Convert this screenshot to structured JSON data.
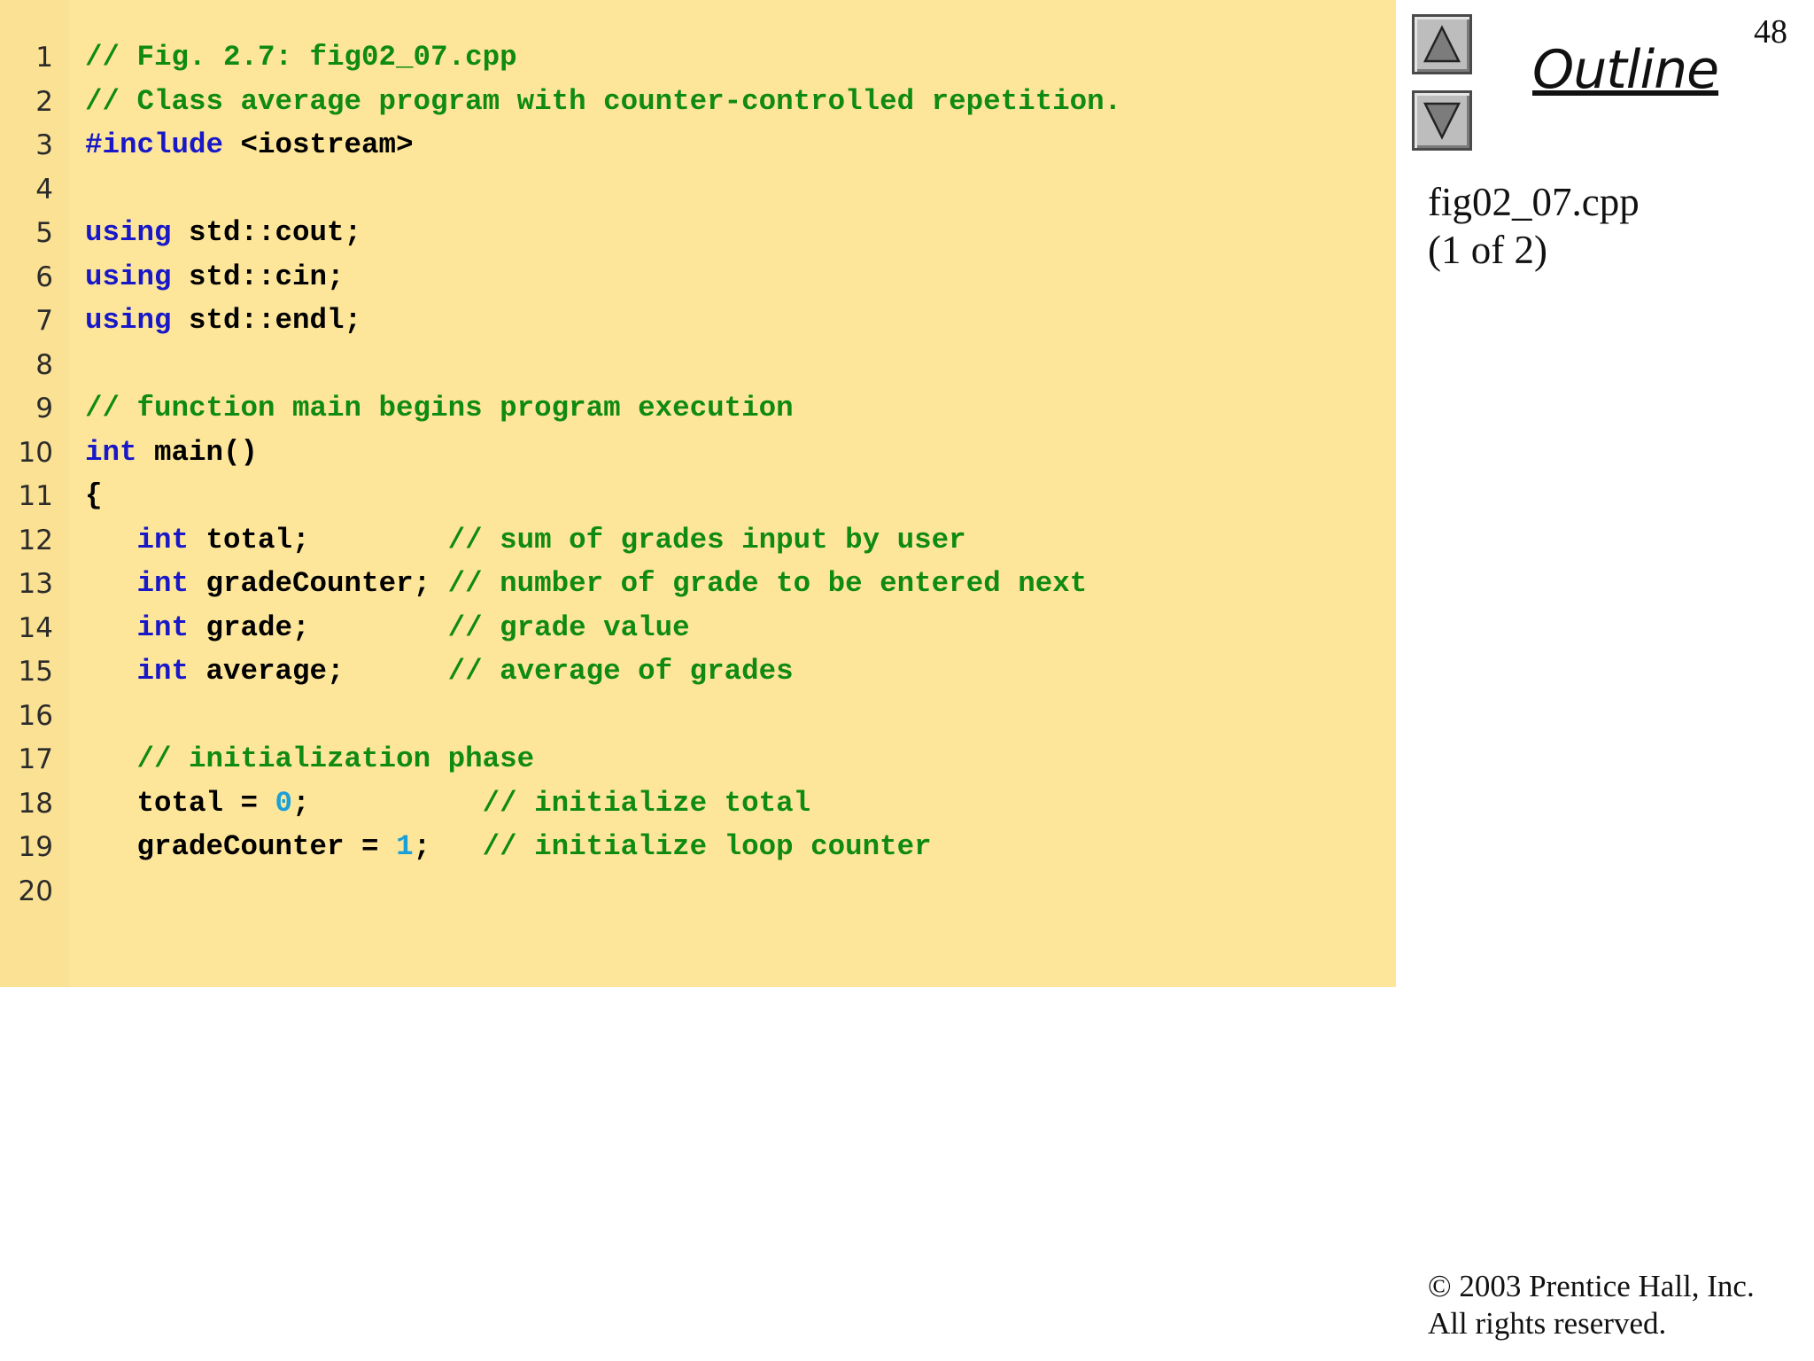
{
  "slide": {
    "page_number": "48",
    "outline_label": "Outline",
    "file_name": "fig02_07.cpp",
    "file_part": "(1 of 2)",
    "copyright_line1": "© 2003 Prentice Hall, Inc.",
    "copyright_line2": "All rights reserved.",
    "nav_up_icon": "triangle-up-icon",
    "nav_down_icon": "triangle-down-icon"
  },
  "colors": {
    "panel": "#fde69a",
    "keyword": "#1818c8",
    "comment": "#0f8a12",
    "number": "#1aa0d8",
    "plain": "#000000"
  },
  "code": [
    {
      "num": "1",
      "tokens": [
        {
          "t": "cm",
          "v": "// Fig. 2.7: fig02_07.cpp"
        }
      ]
    },
    {
      "num": "2",
      "tokens": [
        {
          "t": "cm",
          "v": "// Class average program with counter-controlled repetition."
        }
      ]
    },
    {
      "num": "3",
      "tokens": [
        {
          "t": "kw",
          "v": "#include"
        },
        {
          "t": "pl",
          "v": " <iostream>"
        }
      ]
    },
    {
      "num": "4",
      "tokens": []
    },
    {
      "num": "5",
      "tokens": [
        {
          "t": "kw",
          "v": "using"
        },
        {
          "t": "pl",
          "v": " std::cout;"
        }
      ]
    },
    {
      "num": "6",
      "tokens": [
        {
          "t": "kw",
          "v": "using"
        },
        {
          "t": "pl",
          "v": " std::cin;"
        }
      ]
    },
    {
      "num": "7",
      "tokens": [
        {
          "t": "kw",
          "v": "using"
        },
        {
          "t": "pl",
          "v": " std::endl;"
        }
      ]
    },
    {
      "num": "8",
      "tokens": []
    },
    {
      "num": "9",
      "tokens": [
        {
          "t": "cm",
          "v": "// function main begins program execution"
        }
      ]
    },
    {
      "num": "10",
      "tokens": [
        {
          "t": "kw",
          "v": "int"
        },
        {
          "t": "pl",
          "v": " main()"
        }
      ]
    },
    {
      "num": "11",
      "tokens": [
        {
          "t": "pl",
          "v": "{"
        }
      ]
    },
    {
      "num": "12",
      "tokens": [
        {
          "t": "pl",
          "v": "   "
        },
        {
          "t": "kw",
          "v": "int"
        },
        {
          "t": "pl",
          "v": " total;        "
        },
        {
          "t": "cm",
          "v": "// sum of grades input by user"
        }
      ]
    },
    {
      "num": "13",
      "tokens": [
        {
          "t": "pl",
          "v": "   "
        },
        {
          "t": "kw",
          "v": "int"
        },
        {
          "t": "pl",
          "v": " gradeCounter; "
        },
        {
          "t": "cm",
          "v": "// number of grade to be entered next"
        }
      ]
    },
    {
      "num": "14",
      "tokens": [
        {
          "t": "pl",
          "v": "   "
        },
        {
          "t": "kw",
          "v": "int"
        },
        {
          "t": "pl",
          "v": " grade;        "
        },
        {
          "t": "cm",
          "v": "// grade value"
        }
      ]
    },
    {
      "num": "15",
      "tokens": [
        {
          "t": "pl",
          "v": "   "
        },
        {
          "t": "kw",
          "v": "int"
        },
        {
          "t": "pl",
          "v": " average;      "
        },
        {
          "t": "cm",
          "v": "// average of grades"
        }
      ]
    },
    {
      "num": "16",
      "tokens": []
    },
    {
      "num": "17",
      "tokens": [
        {
          "t": "pl",
          "v": "   "
        },
        {
          "t": "cm",
          "v": "// initialization phase"
        }
      ]
    },
    {
      "num": "18",
      "tokens": [
        {
          "t": "pl",
          "v": "   total = "
        },
        {
          "t": "num",
          "v": "0"
        },
        {
          "t": "pl",
          "v": ";          "
        },
        {
          "t": "cm",
          "v": "// initialize total"
        }
      ]
    },
    {
      "num": "19",
      "tokens": [
        {
          "t": "pl",
          "v": "   gradeCounter = "
        },
        {
          "t": "num",
          "v": "1"
        },
        {
          "t": "pl",
          "v": ";   "
        },
        {
          "t": "cm",
          "v": "// initialize loop counter"
        }
      ]
    },
    {
      "num": "20",
      "tokens": []
    }
  ]
}
